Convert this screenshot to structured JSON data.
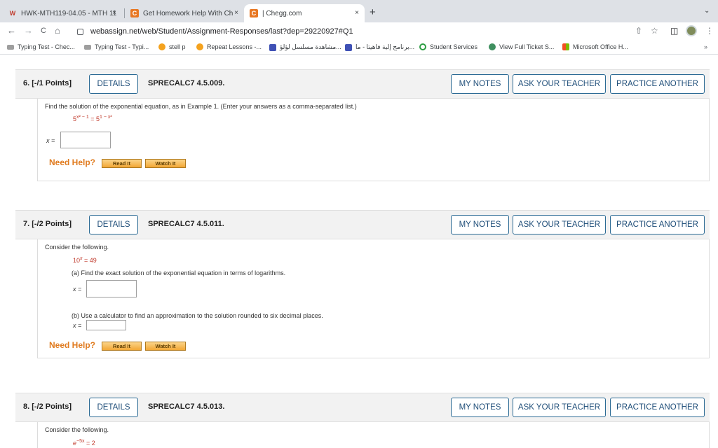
{
  "browser": {
    "tabs": [
      {
        "title": "HWK-MTH119-04.05 - MTH 11",
        "close": "×"
      },
      {
        "title": "Get Homework Help With Che",
        "close": "×"
      },
      {
        "title": "| Chegg.com",
        "close": "×"
      }
    ],
    "new_tab": "+",
    "tab_menu": "⌄",
    "url": "webassign.net/web/Student/Assignment-Responses/last?dep=29220927#Q1",
    "nav": {
      "back": "←",
      "forward": "→",
      "reload": "C",
      "home": "⌂"
    },
    "toolbar_icons": {
      "share": "⇧",
      "star": "☆",
      "sidepanel": "◫",
      "menu": "⋮"
    },
    "bookmarks": [
      {
        "label": "Typing Test - Chec...",
        "icon": "keyboard-icon",
        "color": "#5f6368"
      },
      {
        "label": "Typing Test - Typi...",
        "icon": "keyboard-icon",
        "color": "#5f6368"
      },
      {
        "label": "stell p",
        "icon": "flame-icon",
        "color": "#f4a21e"
      },
      {
        "label": "Repeat Lessons -...",
        "icon": "flame-icon",
        "color": "#f4a21e"
      },
      {
        "label": "مشاهدة مسلسل لؤلؤ...",
        "icon": "m-icon",
        "color": "#3f51b5"
      },
      {
        "label": "برنامج إلية فاهيتا - ما...",
        "icon": "n-icon",
        "color": "#3f51b5"
      },
      {
        "label": "Student Services",
        "icon": "ring-icon",
        "color": "#2e9e44"
      },
      {
        "label": "View Full Ticket S...",
        "icon": "help-icon",
        "color": "#3f8f5f"
      },
      {
        "label": "Microsoft Office H...",
        "icon": "ms-icon",
        "color": "#f25022"
      }
    ],
    "bookmarks_more": "»"
  },
  "questions": [
    {
      "number": "6. [-/1 Points]",
      "details": "DETAILS",
      "ref": "SPRECALC7 4.5.009.",
      "my_notes": "MY NOTES",
      "ask": "ASK YOUR TEACHER",
      "practice": "PRACTICE ANOTHER",
      "prompt": "Find the solution of the exponential equation, as in Example 1. (Enter your answers as a comma-separated list.)",
      "equation": {
        "lhs_base": "5",
        "lhs_exp": "x² − 1",
        "eq": " = ",
        "rhs_base": "5",
        "rhs_exp": "1 − x²"
      },
      "answer_label": "x =",
      "need_help": "Need Help?",
      "read_it": "Read It",
      "watch_it": "Watch It"
    },
    {
      "number": "7. [-/2 Points]",
      "details": "DETAILS",
      "ref": "SPRECALC7 4.5.011.",
      "my_notes": "MY NOTES",
      "ask": "ASK YOUR TEACHER",
      "practice": "PRACTICE ANOTHER",
      "prompt": "Consider the following.",
      "equation": {
        "base": "10",
        "exp": "x",
        "rest": " = 49"
      },
      "part_a": "(a) Find the exact solution of the exponential equation in terms of logarithms.",
      "part_b": "(b) Use a calculator to find an approximation to the solution rounded to six decimal places.",
      "answer_label": "x =",
      "need_help": "Need Help?",
      "read_it": "Read It",
      "watch_it": "Watch It"
    },
    {
      "number": "8. [-/2 Points]",
      "details": "DETAILS",
      "ref": "SPRECALC7 4.5.013.",
      "my_notes": "MY NOTES",
      "ask": "ASK YOUR TEACHER",
      "practice": "PRACTICE ANOTHER",
      "prompt": "Consider the following.",
      "equation": {
        "base": "e",
        "exp": "−5x",
        "rest": " = 2"
      }
    }
  ]
}
